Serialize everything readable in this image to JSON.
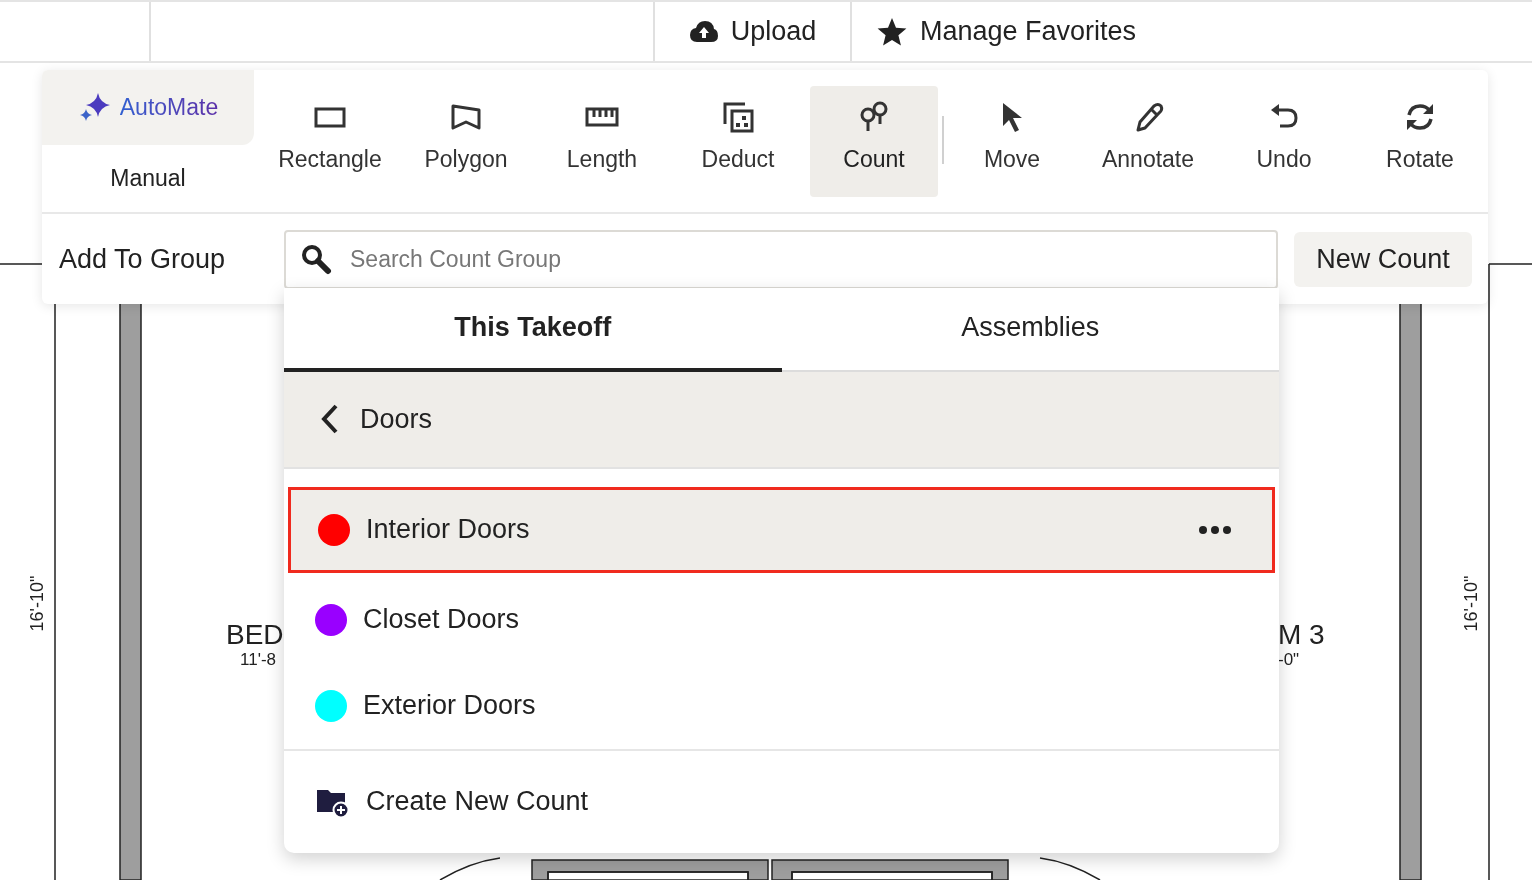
{
  "top_bar": {
    "buttons": [
      {
        "label": "Upload",
        "kind": "upload"
      },
      {
        "label": "Manage Favorites",
        "kind": "star"
      }
    ]
  },
  "mode": {
    "options": [
      {
        "label": "AutoMate",
        "kind": "auto",
        "selected": false
      },
      {
        "label": "Manual",
        "kind": "manual",
        "selected": true
      }
    ]
  },
  "tools": [
    {
      "label": "Rectangle",
      "kind": "rectangle",
      "selected": false
    },
    {
      "label": "Polygon",
      "kind": "polygon",
      "selected": false
    },
    {
      "label": "Length",
      "kind": "length",
      "selected": false
    },
    {
      "label": "Deduct",
      "kind": "deduct",
      "selected": false
    },
    {
      "label": "Count",
      "kind": "count",
      "selected": true
    },
    {
      "label": "Move",
      "kind": "move",
      "selected": false
    },
    {
      "label": "Annotate",
      "kind": "annotate",
      "selected": false
    },
    {
      "label": "Undo",
      "kind": "undo",
      "selected": false
    },
    {
      "label": "Rotate",
      "kind": "rotate",
      "selected": false
    }
  ],
  "group_bar": {
    "label": "Add To Group",
    "search": {
      "placeholder": "Search Count Group"
    },
    "new_button": "New Count"
  },
  "dropdown": {
    "tabs": [
      {
        "label": "This Takeoff",
        "selected": true
      },
      {
        "label": "Assemblies",
        "selected": false
      }
    ],
    "back": "Doors",
    "items": [
      {
        "label": "Interior Doors",
        "color": "#ff0000",
        "selected": true
      },
      {
        "label": "Closet Doors",
        "color": "#9900ff",
        "selected": false
      },
      {
        "label": "Exterior Doors",
        "color": "#00ffff",
        "selected": false
      }
    ],
    "create": "Create New Count"
  },
  "plan": {
    "labels": [
      {
        "text": "16'-10\"",
        "kind": "vertical"
      },
      {
        "text": "BED",
        "kind": "room"
      },
      {
        "text": "11'-8",
        "kind": "size"
      },
      {
        "text": "M 3",
        "kind": "room"
      },
      {
        "text": "-0\"",
        "kind": "size"
      },
      {
        "text": "16'-10\"",
        "kind": "vertical"
      }
    ]
  }
}
